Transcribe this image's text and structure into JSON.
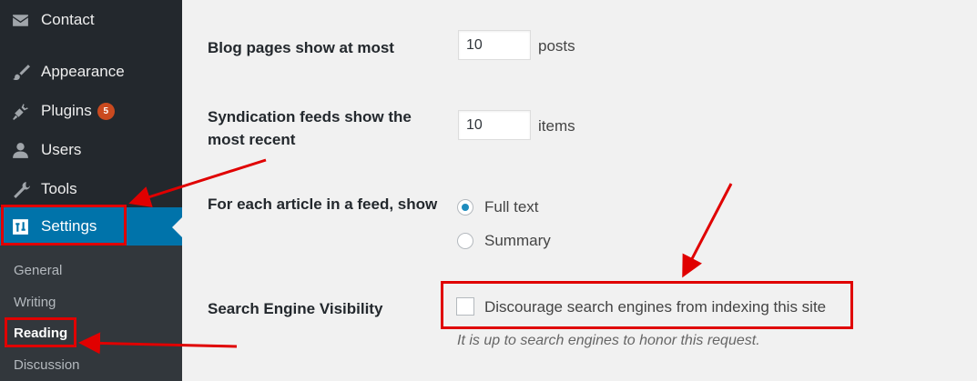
{
  "sidebar": {
    "items": [
      {
        "label": "Contact",
        "icon": "mail-icon"
      },
      {
        "label": "Appearance",
        "icon": "paintbrush-icon"
      },
      {
        "label": "Plugins",
        "icon": "plugin-icon",
        "badge": "5"
      },
      {
        "label": "Users",
        "icon": "user-icon"
      },
      {
        "label": "Tools",
        "icon": "wrench-icon"
      },
      {
        "label": "Settings",
        "icon": "settings-icon",
        "active": true
      }
    ],
    "submenu": [
      "General",
      "Writing",
      "Reading",
      "Discussion"
    ],
    "submenu_current": "Reading"
  },
  "form": {
    "blog_pages": {
      "label": "Blog pages show at most",
      "value": "10",
      "unit": "posts"
    },
    "syndication": {
      "label_line1": "Syndication feeds show the",
      "label_line2": "most recent",
      "value": "10",
      "unit": "items"
    },
    "feed_article": {
      "label": "For each article in a feed, show",
      "options": [
        "Full text",
        "Summary"
      ],
      "selected": "Full text"
    },
    "search_visibility": {
      "label": "Search Engine Visibility",
      "checkbox_label": "Discourage search engines from indexing this site",
      "checked": false,
      "hint": "It is up to search engines to honor this request."
    }
  },
  "colors": {
    "sidebar_bg": "#23282d",
    "submenu_bg": "#32373c",
    "active_bg": "#0073aa",
    "badge": "#ca4a1f",
    "annotation": "#e00000"
  }
}
